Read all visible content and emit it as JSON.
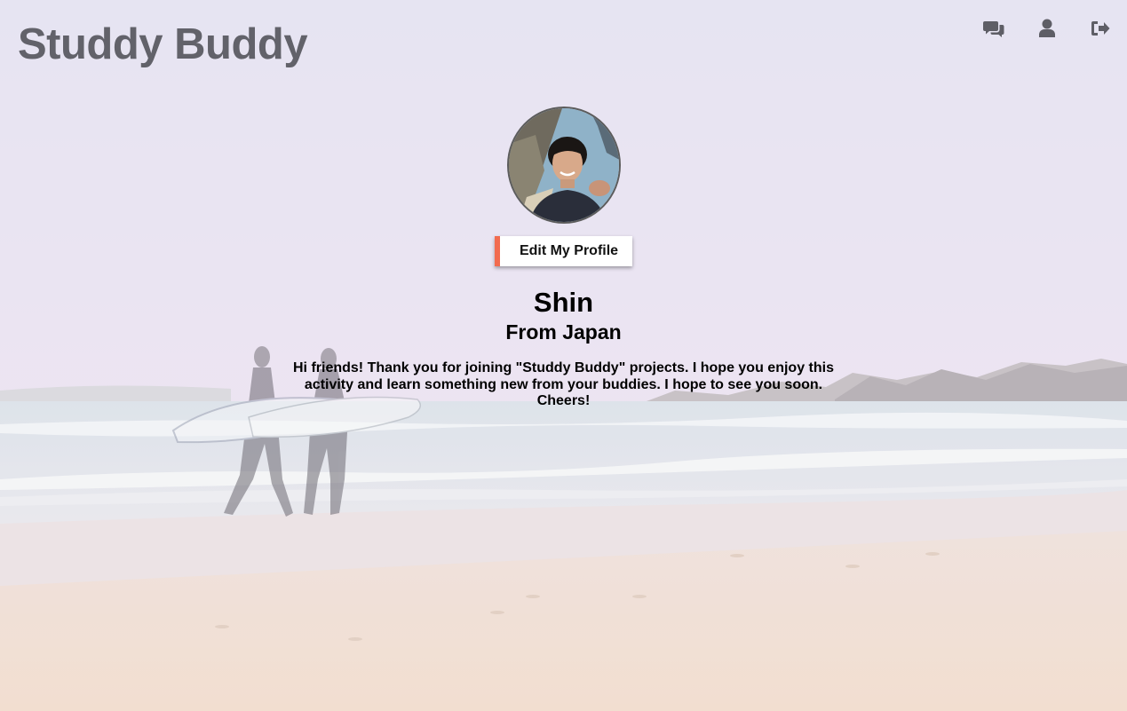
{
  "app": {
    "title": "Studdy Buddy"
  },
  "nav": {
    "icons": [
      "comments-icon",
      "user-icon",
      "sign-out-icon"
    ]
  },
  "profile": {
    "avatar_icon": "profile-photo",
    "edit_label": "Edit My Profile",
    "name": "Shin",
    "origin": "From Japan",
    "bio": "Hi friends! Thank you for joining \"Studdy Buddy\" projects. I hope you enjoy this activity and learn something new from your buddies. I hope to see you soon. Cheers!"
  },
  "colors": {
    "logo": "#62626a",
    "nav_icon": "#5e5e66",
    "accent": "#f26b4f"
  }
}
